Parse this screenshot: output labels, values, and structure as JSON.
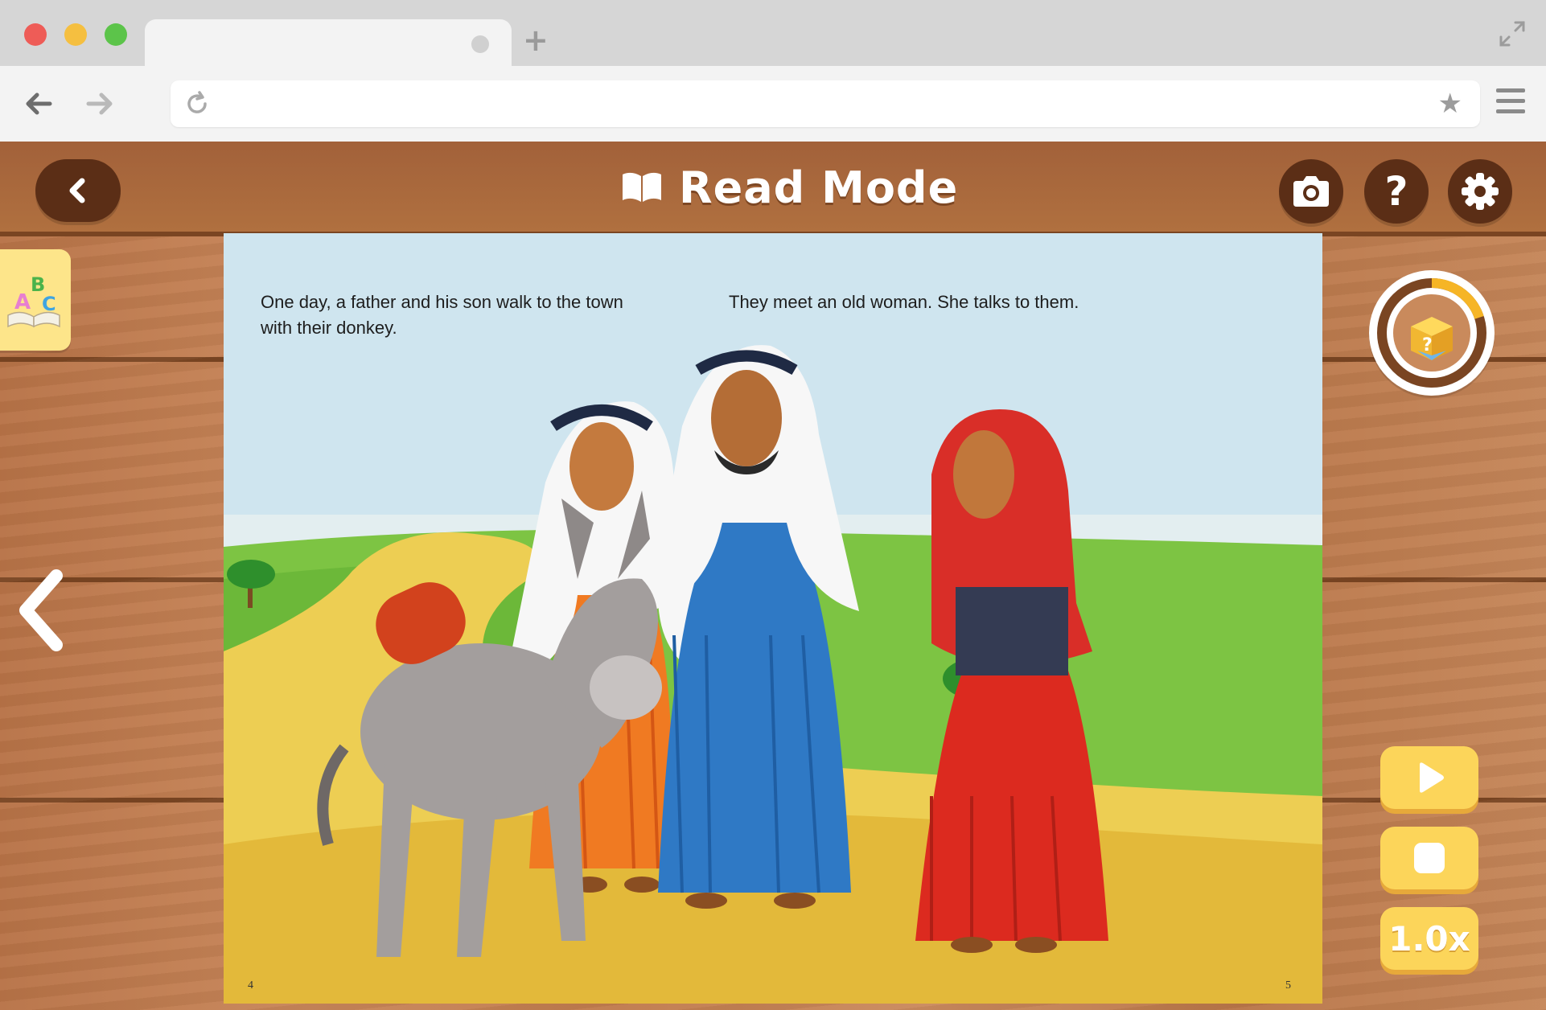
{
  "browser": {
    "colors": {
      "close": "#ee5c57",
      "minimize": "#f5bf40",
      "maximize": "#5cc44a"
    },
    "icons": [
      "back-arrow-icon",
      "forward-arrow-icon",
      "reload-icon",
      "bookmark-star-icon",
      "menu-icon",
      "new-tab-icon",
      "fullscreen-icon"
    ]
  },
  "header": {
    "title": "Read Mode",
    "icons": [
      "back-icon",
      "book-icon",
      "camera-icon",
      "help-icon",
      "settings-icon"
    ],
    "help_glyph": "?"
  },
  "book": {
    "left_page": {
      "text_line1": "One day, a father and his son walk to the town",
      "text_line2": "with their donkey.",
      "page_number": "4"
    },
    "right_page": {
      "text": "They meet an old woman.  She talks to them.",
      "page_number": "5"
    }
  },
  "sidebar": {
    "abc_letters": [
      "A",
      "B",
      "C"
    ],
    "quiz_progress": 0.2
  },
  "controls": {
    "speed_label": "1.0x",
    "icons": [
      "play-icon",
      "stop-icon"
    ]
  },
  "colors": {
    "wood": "#c07b4e",
    "button_dark": "#5b2e16",
    "button_yellow": "#fcd55a",
    "quiz_ring": "#f6b526"
  }
}
